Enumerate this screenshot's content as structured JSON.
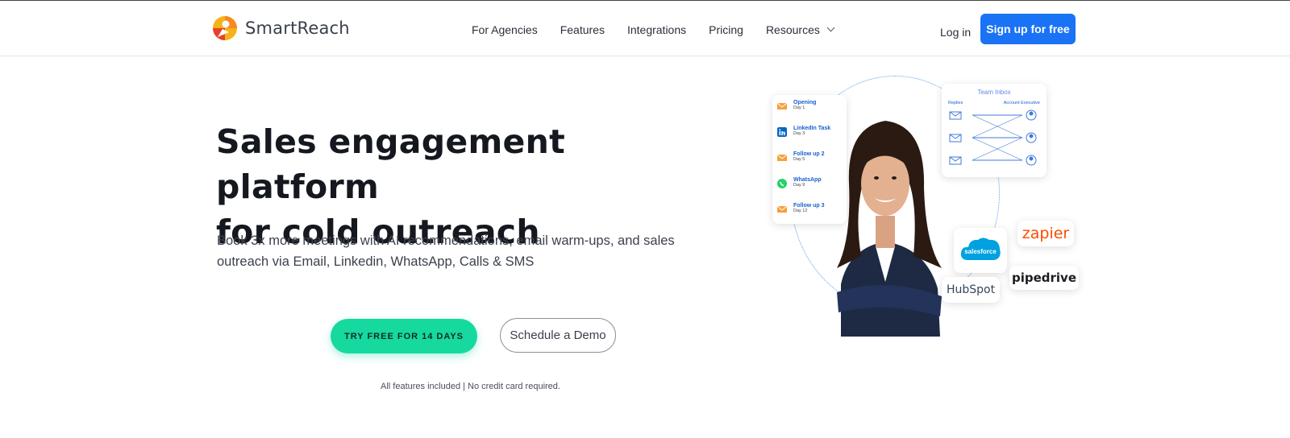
{
  "brand": {
    "name": "SmartReach"
  },
  "nav": {
    "items": [
      "For Agencies",
      "Features",
      "Integrations",
      "Pricing",
      "Resources"
    ],
    "login": "Log in",
    "signup": "Sign up for free"
  },
  "hero": {
    "title_line1": "Sales engagement platform",
    "title_line2": "for cold outreach",
    "subtitle_line1": "Book 3x more meetings with AI recommendations, email warm-ups, and sales",
    "subtitle_line2": "outreach via Email, Linkedin, WhatsApp, Calls & SMS",
    "cta_primary": "TRY FREE FOR 14 DAYS",
    "cta_secondary": "Schedule a Demo",
    "note": "All features included | No credit card required."
  },
  "illustration": {
    "sequence": [
      {
        "label": "Opening",
        "day": "Day 1",
        "icon": "email-icon",
        "color": "#f5a03c"
      },
      {
        "label": "LinkedIn Task",
        "day": "Day 3",
        "icon": "linkedin-icon",
        "color": "#0a66c2"
      },
      {
        "label": "Follow up 2",
        "day": "Day 5",
        "icon": "email-icon",
        "color": "#f5a03c"
      },
      {
        "label": "WhatsApp",
        "day": "Day 9",
        "icon": "whatsapp-icon",
        "color": "#25d366"
      },
      {
        "label": "Follow up 3",
        "day": "Day 12",
        "icon": "email-icon",
        "color": "#f5a03c"
      }
    ],
    "inbox": {
      "title": "Team Inbox",
      "col_left": "Replies",
      "col_right": "Account Executive"
    },
    "integrations": {
      "salesforce": "salesforce",
      "zapier": "zapier",
      "pipedrive": "pipedrive",
      "hubspot": "HubSpot"
    }
  },
  "colors": {
    "primary_blue": "#1a73f5",
    "cta_green": "#16d9a0"
  }
}
